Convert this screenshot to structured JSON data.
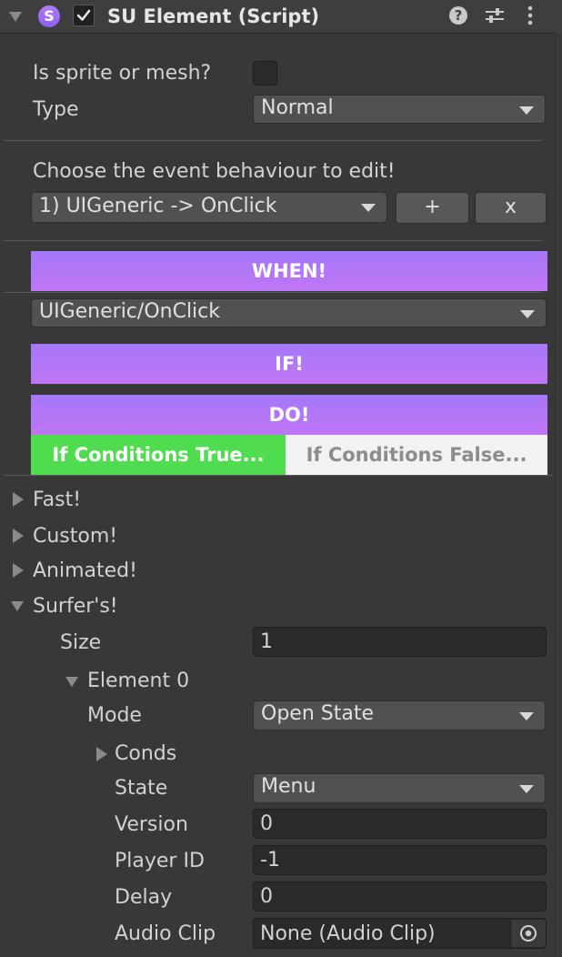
{
  "header": {
    "title": "SU Element (Script)",
    "script_icon_letter": "S",
    "enabled": true,
    "icons": [
      "help-icon",
      "presets-icon",
      "kebab-menu-icon"
    ]
  },
  "fields": {
    "is_sprite_label": "Is sprite or mesh?",
    "is_sprite_checked": false,
    "type_label": "Type",
    "type_value": "Normal"
  },
  "events": {
    "prompt": "Choose the event behaviour to edit!",
    "selected": "1) UIGeneric -> OnClick",
    "add_label": "+",
    "remove_label": "x"
  },
  "when": {
    "banner": "WHEN!",
    "event_value": "UIGeneric/OnClick"
  },
  "if_banner": "IF!",
  "do": {
    "banner": "DO!",
    "tab_true": "If Conditions True...",
    "tab_false": "If Conditions False...",
    "active_tab": "true"
  },
  "foldouts": {
    "fast": "Fast!",
    "custom": "Custom!",
    "animated": "Animated!",
    "surfers": "Surfer's!"
  },
  "surfers": {
    "size_label": "Size",
    "size_value": "1",
    "element_label": "Element 0",
    "mode_label": "Mode",
    "mode_value": "Open State",
    "conds_label": "Conds",
    "state_label": "State",
    "state_value": "Menu",
    "version_label": "Version",
    "version_value": "0",
    "player_id_label": "Player ID",
    "player_id_value": "-1",
    "delay_label": "Delay",
    "delay_value": "0",
    "audio_clip_label": "Audio Clip",
    "audio_clip_value": "None (Audio Clip)"
  },
  "colors": {
    "banner_gradient_top": "#a477f9",
    "banner_gradient_bottom": "#c076f5",
    "tab_true_bg": "#4fdc4f",
    "tab_false_bg": "#f2f2f2",
    "panel_bg": "#383838"
  }
}
